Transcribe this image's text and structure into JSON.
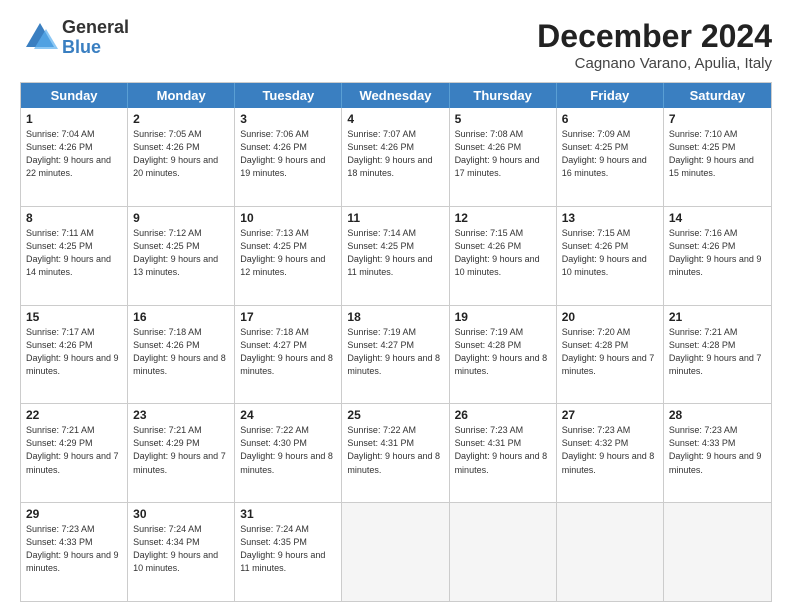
{
  "logo": {
    "general": "General",
    "blue": "Blue"
  },
  "title": "December 2024",
  "subtitle": "Cagnano Varano, Apulia, Italy",
  "header_days": [
    "Sunday",
    "Monday",
    "Tuesday",
    "Wednesday",
    "Thursday",
    "Friday",
    "Saturday"
  ],
  "weeks": [
    [
      {
        "day": "1",
        "sunrise": "7:04 AM",
        "sunset": "4:26 PM",
        "daylight": "9 hours and 22 minutes."
      },
      {
        "day": "2",
        "sunrise": "7:05 AM",
        "sunset": "4:26 PM",
        "daylight": "9 hours and 20 minutes."
      },
      {
        "day": "3",
        "sunrise": "7:06 AM",
        "sunset": "4:26 PM",
        "daylight": "9 hours and 19 minutes."
      },
      {
        "day": "4",
        "sunrise": "7:07 AM",
        "sunset": "4:26 PM",
        "daylight": "9 hours and 18 minutes."
      },
      {
        "day": "5",
        "sunrise": "7:08 AM",
        "sunset": "4:26 PM",
        "daylight": "9 hours and 17 minutes."
      },
      {
        "day": "6",
        "sunrise": "7:09 AM",
        "sunset": "4:25 PM",
        "daylight": "9 hours and 16 minutes."
      },
      {
        "day": "7",
        "sunrise": "7:10 AM",
        "sunset": "4:25 PM",
        "daylight": "9 hours and 15 minutes."
      }
    ],
    [
      {
        "day": "8",
        "sunrise": "7:11 AM",
        "sunset": "4:25 PM",
        "daylight": "9 hours and 14 minutes."
      },
      {
        "day": "9",
        "sunrise": "7:12 AM",
        "sunset": "4:25 PM",
        "daylight": "9 hours and 13 minutes."
      },
      {
        "day": "10",
        "sunrise": "7:13 AM",
        "sunset": "4:25 PM",
        "daylight": "9 hours and 12 minutes."
      },
      {
        "day": "11",
        "sunrise": "7:14 AM",
        "sunset": "4:25 PM",
        "daylight": "9 hours and 11 minutes."
      },
      {
        "day": "12",
        "sunrise": "7:15 AM",
        "sunset": "4:26 PM",
        "daylight": "9 hours and 10 minutes."
      },
      {
        "day": "13",
        "sunrise": "7:15 AM",
        "sunset": "4:26 PM",
        "daylight": "9 hours and 10 minutes."
      },
      {
        "day": "14",
        "sunrise": "7:16 AM",
        "sunset": "4:26 PM",
        "daylight": "9 hours and 9 minutes."
      }
    ],
    [
      {
        "day": "15",
        "sunrise": "7:17 AM",
        "sunset": "4:26 PM",
        "daylight": "9 hours and 9 minutes."
      },
      {
        "day": "16",
        "sunrise": "7:18 AM",
        "sunset": "4:26 PM",
        "daylight": "9 hours and 8 minutes."
      },
      {
        "day": "17",
        "sunrise": "7:18 AM",
        "sunset": "4:27 PM",
        "daylight": "9 hours and 8 minutes."
      },
      {
        "day": "18",
        "sunrise": "7:19 AM",
        "sunset": "4:27 PM",
        "daylight": "9 hours and 8 minutes."
      },
      {
        "day": "19",
        "sunrise": "7:19 AM",
        "sunset": "4:28 PM",
        "daylight": "9 hours and 8 minutes."
      },
      {
        "day": "20",
        "sunrise": "7:20 AM",
        "sunset": "4:28 PM",
        "daylight": "9 hours and 7 minutes."
      },
      {
        "day": "21",
        "sunrise": "7:21 AM",
        "sunset": "4:28 PM",
        "daylight": "9 hours and 7 minutes."
      }
    ],
    [
      {
        "day": "22",
        "sunrise": "7:21 AM",
        "sunset": "4:29 PM",
        "daylight": "9 hours and 7 minutes."
      },
      {
        "day": "23",
        "sunrise": "7:21 AM",
        "sunset": "4:29 PM",
        "daylight": "9 hours and 7 minutes."
      },
      {
        "day": "24",
        "sunrise": "7:22 AM",
        "sunset": "4:30 PM",
        "daylight": "9 hours and 8 minutes."
      },
      {
        "day": "25",
        "sunrise": "7:22 AM",
        "sunset": "4:31 PM",
        "daylight": "9 hours and 8 minutes."
      },
      {
        "day": "26",
        "sunrise": "7:23 AM",
        "sunset": "4:31 PM",
        "daylight": "9 hours and 8 minutes."
      },
      {
        "day": "27",
        "sunrise": "7:23 AM",
        "sunset": "4:32 PM",
        "daylight": "9 hours and 8 minutes."
      },
      {
        "day": "28",
        "sunrise": "7:23 AM",
        "sunset": "4:33 PM",
        "daylight": "9 hours and 9 minutes."
      }
    ],
    [
      {
        "day": "29",
        "sunrise": "7:23 AM",
        "sunset": "4:33 PM",
        "daylight": "9 hours and 9 minutes."
      },
      {
        "day": "30",
        "sunrise": "7:24 AM",
        "sunset": "4:34 PM",
        "daylight": "9 hours and 10 minutes."
      },
      {
        "day": "31",
        "sunrise": "7:24 AM",
        "sunset": "4:35 PM",
        "daylight": "9 hours and 11 minutes."
      },
      null,
      null,
      null,
      null
    ]
  ]
}
